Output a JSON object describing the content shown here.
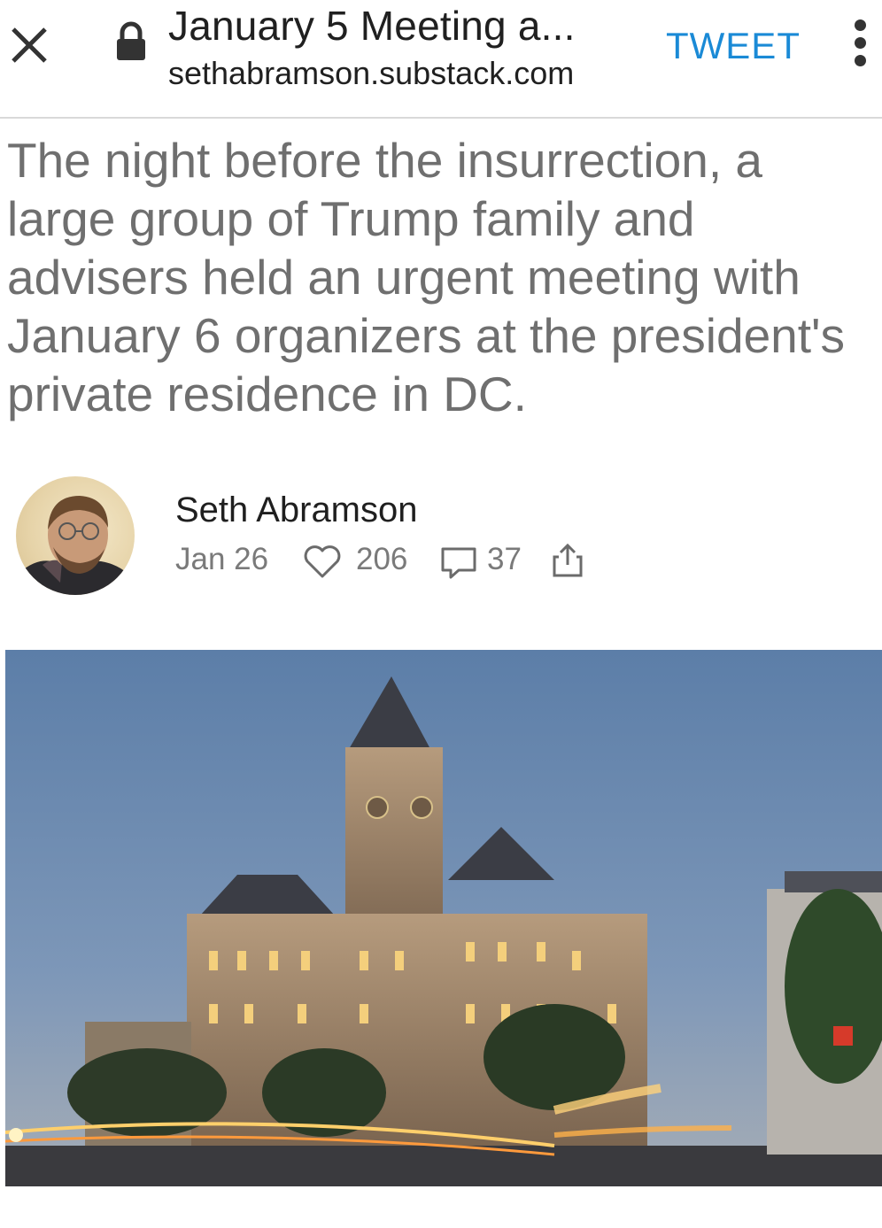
{
  "browser": {
    "page_title": "January 5 Meeting a...",
    "domain": "sethabramson.substack.com",
    "action_label": "TWEET",
    "close_icon": "close-icon",
    "lock_icon": "lock-icon",
    "more_icon": "more-vert-icon"
  },
  "article": {
    "headline": "The night before the insurrection, a large group of Trump family and advisers held an urgent meeting with January 6 organizers at the president's private residence in DC.",
    "author": "Seth Abramson",
    "date": "Jan 26",
    "likes": "206",
    "comments": "37",
    "icons": [
      "heart-icon",
      "comment-icon",
      "share-icon"
    ]
  },
  "colors": {
    "accent": "#1a8ad6",
    "headline": "#6f6f6f",
    "meta": "#7a7a7a"
  }
}
